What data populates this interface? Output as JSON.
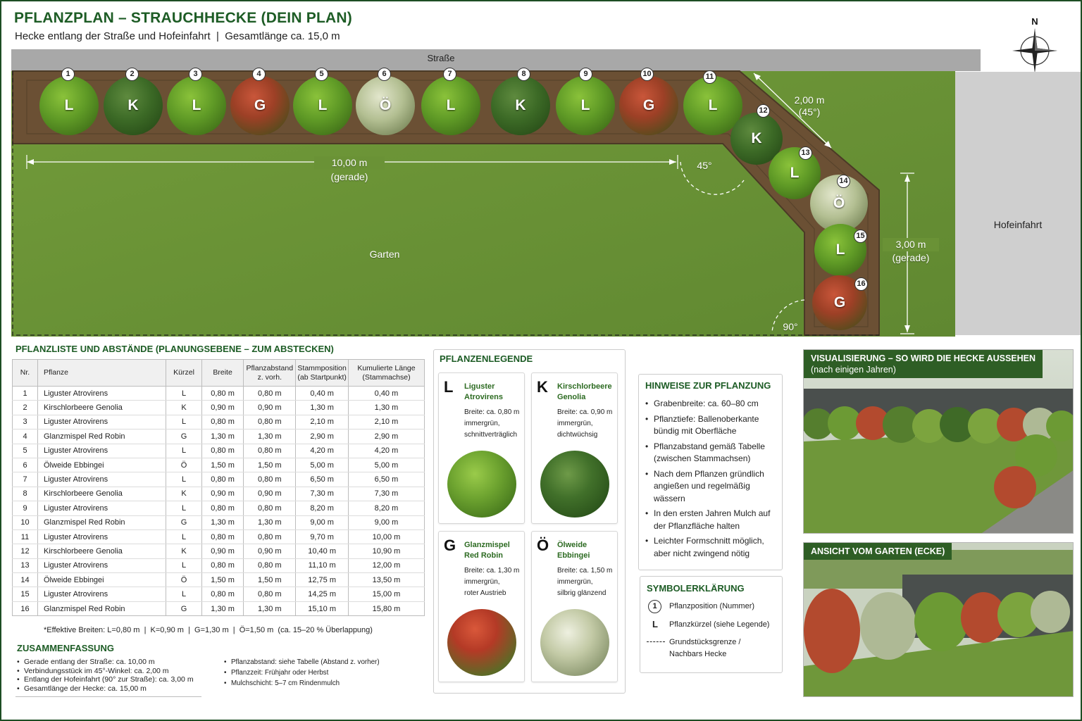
{
  "header": {
    "title": "PFLANZPLAN – STRAUCHHECKE (DEIN PLAN)",
    "subtitle": "Hecke entlang der Straße und Hofeinfahrt  |  Gesamtlänge ca. 15,0 m",
    "north": "N"
  },
  "plan": {
    "street": "Straße",
    "garden": "Garten",
    "driveway": "Hofeinfahrt",
    "dim_straight": "10,00 m",
    "dim_straight_note": "(gerade)",
    "dim_diagonal": "2,00 m",
    "dim_diagonal_note": "(45°)",
    "dim_side": "3,00 m",
    "dim_side_note": "(gerade)",
    "angle_45": "45°",
    "angle_90": "90°",
    "plants": [
      {
        "nr": "1",
        "code": "L",
        "type": "L"
      },
      {
        "nr": "2",
        "code": "K",
        "type": "K"
      },
      {
        "nr": "3",
        "code": "L",
        "type": "L"
      },
      {
        "nr": "4",
        "code": "G",
        "type": "G"
      },
      {
        "nr": "5",
        "code": "L",
        "type": "L"
      },
      {
        "nr": "6",
        "code": "Ö",
        "type": "O"
      },
      {
        "nr": "7",
        "code": "L",
        "type": "L"
      },
      {
        "nr": "8",
        "code": "K",
        "type": "K"
      },
      {
        "nr": "9",
        "code": "L",
        "type": "L"
      },
      {
        "nr": "10",
        "code": "G",
        "type": "G"
      },
      {
        "nr": "11",
        "code": "L",
        "type": "L"
      },
      {
        "nr": "12",
        "code": "K",
        "type": "K"
      },
      {
        "nr": "13",
        "code": "L",
        "type": "L"
      },
      {
        "nr": "14",
        "code": "Ö",
        "type": "O"
      },
      {
        "nr": "15",
        "code": "L",
        "type": "L"
      },
      {
        "nr": "16",
        "code": "G",
        "type": "G"
      }
    ]
  },
  "table": {
    "title": "PFLANZLISTE UND ABSTÄNDE (PLANUNGSEBENE – ZUM ABSTECKEN)",
    "headers": [
      "Nr.",
      "Pflanze",
      "Kürzel",
      "Breite",
      "Pflanzabstand\nz. vorh.",
      "Stammposition\n(ab Startpunkt)",
      "Kumulierte Länge\n(Stammachse)"
    ],
    "rows": [
      [
        "1",
        "Liguster Atrovirens",
        "L",
        "0,80 m",
        "0,80 m",
        "0,40 m",
        "0,40 m"
      ],
      [
        "2",
        "Kirschlorbeere Genolia",
        "K",
        "0,90 m",
        "0,90 m",
        "1,30 m",
        "1,30 m"
      ],
      [
        "3",
        "Liguster Atrovirens",
        "L",
        "0,80 m",
        "0,80 m",
        "2,10 m",
        "2,10 m"
      ],
      [
        "4",
        "Glanzmispel Red Robin",
        "G",
        "1,30 m",
        "1,30 m",
        "2,90 m",
        "2,90 m"
      ],
      [
        "5",
        "Liguster Atrovirens",
        "L",
        "0,80 m",
        "0,80 m",
        "4,20 m",
        "4,20 m"
      ],
      [
        "6",
        "Ölweide Ebbingei",
        "Ö",
        "1,50 m",
        "1,50 m",
        "5,00 m",
        "5,00 m"
      ],
      [
        "7",
        "Liguster Atrovirens",
        "L",
        "0,80 m",
        "0,80 m",
        "6,50 m",
        "6,50 m"
      ],
      [
        "8",
        "Kirschlorbeere Genolia",
        "K",
        "0,90 m",
        "0,90 m",
        "7,30 m",
        "7,30 m"
      ],
      [
        "9",
        "Liguster Atrovirens",
        "L",
        "0,80 m",
        "0,80 m",
        "8,20 m",
        "8,20 m"
      ],
      [
        "10",
        "Glanzmispel Red Robin",
        "G",
        "1,30 m",
        "1,30 m",
        "9,00 m",
        "9,00 m"
      ],
      [
        "11",
        "Liguster Atrovirens",
        "L",
        "0,80 m",
        "0,80 m",
        "9,70 m",
        "10,00 m"
      ],
      [
        "12",
        "Kirschlorbeere Genolia",
        "K",
        "0,90 m",
        "0,90 m",
        "10,40 m",
        "10,90 m"
      ],
      [
        "13",
        "Liguster Atrovirens",
        "L",
        "0,80 m",
        "0,80 m",
        "11,10 m",
        "12,00 m"
      ],
      [
        "14",
        "Ölweide Ebbingei",
        "Ö",
        "1,50 m",
        "1,50 m",
        "12,75 m",
        "13,50 m"
      ],
      [
        "15",
        "Liguster Atrovirens",
        "L",
        "0,80 m",
        "0,80 m",
        "14,25 m",
        "15,00 m"
      ],
      [
        "16",
        "Glanzmispel Red Robin",
        "G",
        "1,30 m",
        "1,30 m",
        "15,10 m",
        "15,80 m"
      ]
    ],
    "footnote": "*Effektive Breiten: L=0,80 m  |  K=0,90 m  |  G=1,30 m  |  Ö=1,50 m  (ca. 15–20 % Überlappung)"
  },
  "summary": {
    "title": "ZUSAMMENFASSUNG",
    "items": [
      "Gerade entlang der Straße: ca. 10,00 m",
      "Verbindungsstück im 45°-Winkel: ca. 2,00 m",
      "Entlang der Hofeinfahrt (90° zur Straße): ca. 3,00 m",
      "Gesamtlänge der Hecke: ca. 15,00 m"
    ],
    "notes": [
      "Pflanzabstand: siehe Tabelle (Abstand z. vorher)",
      "Pflanzzeit: Frühjahr oder Herbst",
      "Mulchschicht: 5–7 cm Rindenmulch"
    ]
  },
  "legend": {
    "title": "PFLANZENLEGENDE",
    "cards": [
      {
        "code": "L",
        "name": "Liguster Atrovirens",
        "desc": "Breite: ca. 0,80 m\nimmergrün,\nschnittverträglich",
        "type": "L"
      },
      {
        "code": "K",
        "name": "Kirschlorbeere Genolia",
        "desc": "Breite: ca. 0,90 m\nimmergrün,\ndichtwüchsig",
        "type": "K"
      },
      {
        "code": "G",
        "name": "Glanzmispel Red Robin",
        "desc": "Breite: ca. 1,30 m\nimmergrün,\nroter Austrieb",
        "type": "G"
      },
      {
        "code": "Ö",
        "name": "Ölweide Ebbingei",
        "desc": "Breite: ca. 1,50 m\nimmergrün,\nsilbrig glänzend",
        "type": "O"
      }
    ]
  },
  "hints": {
    "title": "HINWEISE ZUR PFLANZUNG",
    "items": [
      "Grabenbreite: ca. 60–80 cm",
      "Pflanztiefe: Ballenoberkante bündig mit Oberfläche",
      "Pflanzabstand gemäß Tabelle (zwischen Stammachsen)",
      "Nach dem Pflanzen gründlich angießen und regelmäßig wässern",
      "In den ersten Jahren Mulch auf der Pflanzfläche halten",
      "Leichter Formschnitt möglich, aber nicht zwingend nötig"
    ]
  },
  "symbols": {
    "title": "SYMBOLERKLÄRUNG",
    "num_symbol": "1",
    "num_label": "Pflanzposition (Nummer)",
    "code_symbol": "L",
    "code_label": "Pflanzkürzel (siehe Legende)",
    "line_label": "Grundstücksgrenze / Nachbars Hecke"
  },
  "visuals": {
    "vis1_title": "VISUALISIERUNG – SO WIRD DIE HECKE AUSSEHEN",
    "vis1_sub": "(nach einigen Jahren)",
    "vis2_title": "ANSICHT VOM GARTEN (ECKE)"
  }
}
